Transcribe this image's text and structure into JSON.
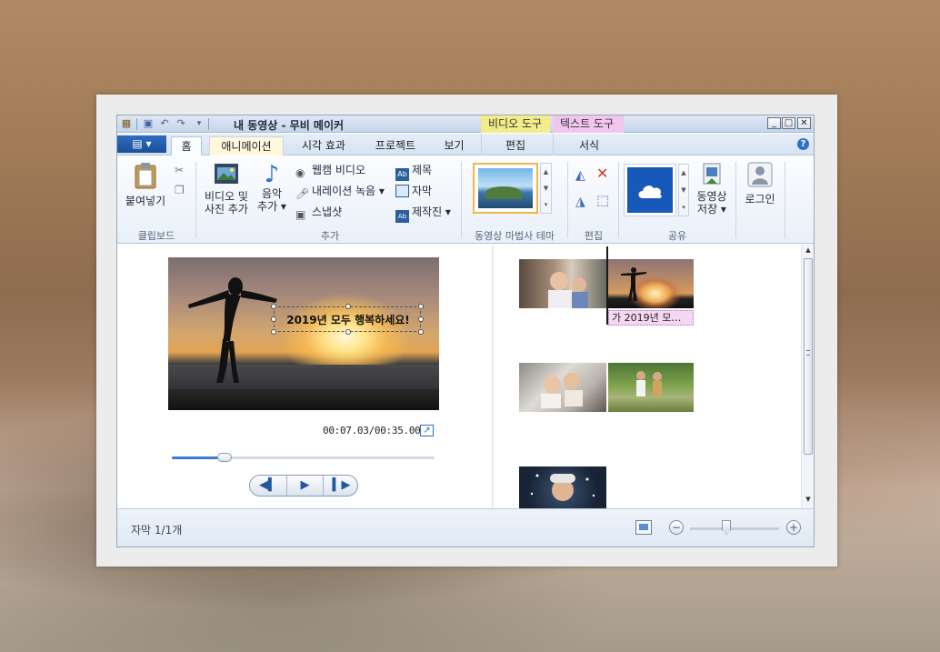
{
  "window": {
    "title": "내 동영상 - 무비 메이커",
    "contextual_tabs": {
      "video_tools": "비디오 도구",
      "text_tools": "텍스트 도구"
    },
    "colors": {
      "video_tools": "#f3ec8a",
      "text_tools": "#f0c6ef",
      "file_button": "#1f5aa8"
    }
  },
  "tabs": [
    {
      "label": "홈",
      "active": true
    },
    {
      "label": "애니메이션"
    },
    {
      "label": "시각 효과"
    },
    {
      "label": "프로젝트"
    },
    {
      "label": "보기"
    },
    {
      "label": "편집"
    },
    {
      "label": "서식"
    }
  ],
  "ribbon": {
    "clipboard": {
      "paste": "붙여넣기",
      "group": "클립보드"
    },
    "add": {
      "add_video": [
        "비디오 및",
        "사진 추가"
      ],
      "add_music": [
        "음악",
        "추가 ▾"
      ],
      "webcam": "웹캠 비디오",
      "narration": "내레이션 녹음 ▾",
      "snapshot": "스냅샷",
      "title": "제목",
      "caption": "자막",
      "credits": "제작진 ▾",
      "group": "추가"
    },
    "themes": {
      "group": "동영상 마법사 테마"
    },
    "editing": {
      "group": "편집"
    },
    "share": {
      "save_movie": [
        "동영상",
        "저장 ▾"
      ],
      "group": "공유"
    },
    "signin": {
      "label": "로그인"
    }
  },
  "preview": {
    "caption_text": "2019년 모두 행복하세요!",
    "time": "00:07.03/00:35.00",
    "progress": 0.2
  },
  "storyboard": {
    "caption_clip": "가 2019년 모…"
  },
  "status": {
    "caption_count": "자막 1/1개",
    "zoom_level": 0.4
  },
  "icons": [
    "file-menu-icon",
    "save-icon",
    "undo-icon",
    "redo-icon",
    "paste-icon",
    "cut-icon",
    "copy-icon",
    "film-icon",
    "music-note-icon",
    "webcam-icon",
    "microphone-icon",
    "camera-icon",
    "title-icon",
    "caption-icon",
    "credits-icon",
    "rotate-left-icon",
    "delete-icon",
    "rotate-right-icon",
    "select-all-icon",
    "onedrive-icon",
    "save-movie-icon",
    "user-icon",
    "expand-icon",
    "play-icon",
    "previous-frame-icon",
    "next-frame-icon",
    "monitor-icon",
    "zoom-out-icon",
    "zoom-in-icon",
    "help-icon"
  ]
}
